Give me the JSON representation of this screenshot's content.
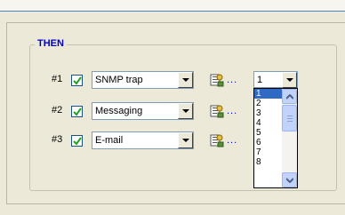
{
  "group": {
    "title": "THEN"
  },
  "rows": [
    {
      "label": "#1",
      "checked": true,
      "action": "SNMP trap",
      "ellipsis": "..."
    },
    {
      "label": "#2",
      "checked": true,
      "action": "Messaging",
      "ellipsis": "..."
    },
    {
      "label": "#3",
      "checked": true,
      "action": "E-mail",
      "ellipsis": "..."
    }
  ],
  "combo": {
    "value": "1",
    "options": [
      "1",
      "2",
      "3",
      "4",
      "5",
      "6",
      "7",
      "8"
    ],
    "selected_option": "1"
  },
  "colors": {
    "accent": "#0000c8",
    "selection": "#316ac5",
    "scrollbar": "#c1d3fb",
    "window": "#ece9d8"
  }
}
